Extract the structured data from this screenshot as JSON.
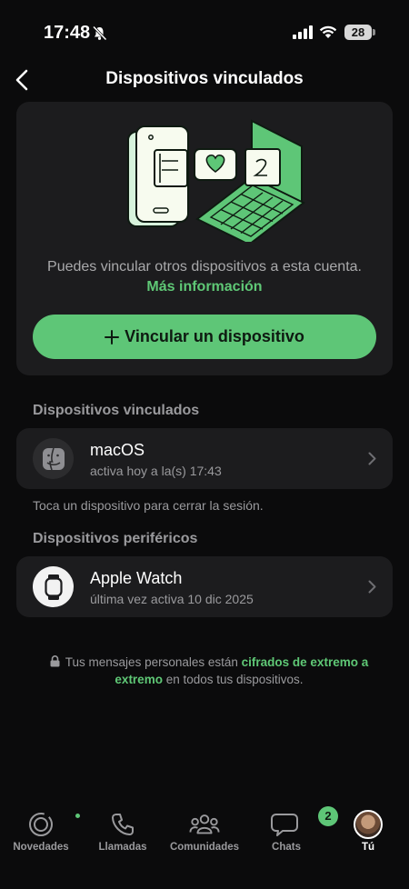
{
  "status_bar": {
    "time": "17:48",
    "battery": "28"
  },
  "nav": {
    "title": "Dispositivos vinculados"
  },
  "hero": {
    "description": "Puedes vincular otros dispositivos a esta cuenta.",
    "more_info": "Más información",
    "link_button": "Vincular un dispositivo"
  },
  "linked_section": {
    "header": "Dispositivos vinculados",
    "devices": [
      {
        "name": "macOS",
        "status": "activa hoy a la(s) 17:43",
        "icon": "finder-icon"
      }
    ],
    "hint": "Toca un dispositivo para cerrar la sesión."
  },
  "peripheral_section": {
    "header": "Dispositivos periféricos",
    "devices": [
      {
        "name": "Apple Watch",
        "status": "última vez activa 10 dic 2025",
        "icon": "watch-icon"
      }
    ]
  },
  "encryption": {
    "prefix": "Tus mensajes personales están",
    "highlight": "cifrados de extremo a extremo",
    "suffix": "en todos tus dispositivos."
  },
  "tabs": [
    {
      "label": "Novedades",
      "icon": "status-icon"
    },
    {
      "label": "Llamadas",
      "icon": "phone-icon"
    },
    {
      "label": "Comunidades",
      "icon": "communities-icon"
    },
    {
      "label": "Chats",
      "icon": "chats-icon",
      "badge": "2"
    },
    {
      "label": "Tú",
      "icon": "avatar",
      "active": true
    }
  ],
  "colors": {
    "accent": "#5ec677",
    "background": "#0b0b0c",
    "card": "#1c1c1e"
  }
}
